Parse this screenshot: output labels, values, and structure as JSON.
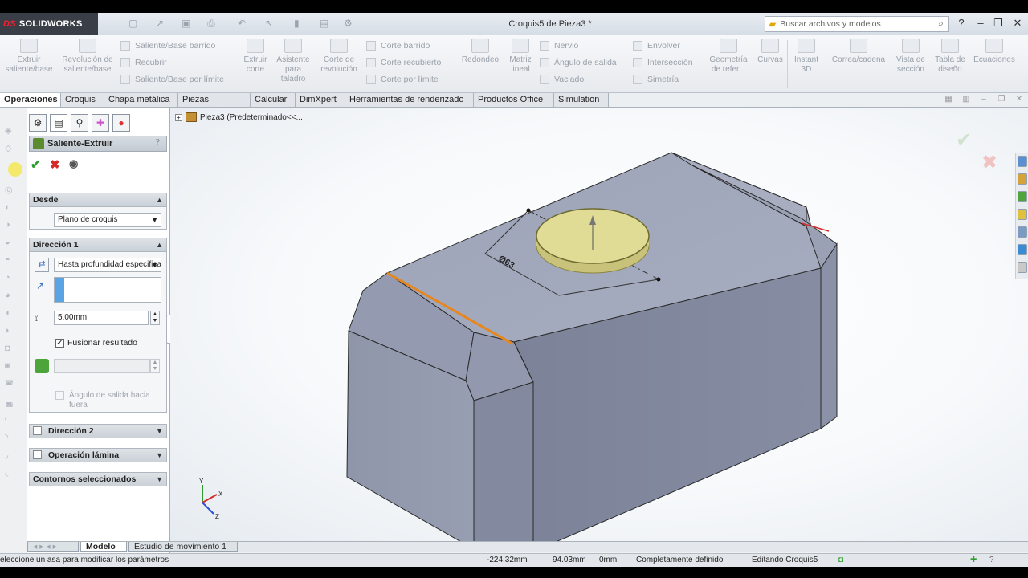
{
  "app": {
    "logo": "SOLIDWORKS",
    "document_title": "Croquis5 de Pieza3 *",
    "search_placeholder": "Buscar archivos y modelos"
  },
  "ribbon": {
    "large": [
      {
        "label": "Extruir saliente/base"
      },
      {
        "label": "Revolución de saliente/base"
      },
      {
        "label": "Extruir corte"
      },
      {
        "label": "Asistente para taladro"
      },
      {
        "label": "Corte de revolución"
      },
      {
        "label": "Redondeo"
      },
      {
        "label": "Matriz lineal"
      },
      {
        "label": "Geometría de refer..."
      },
      {
        "label": "Curvas"
      },
      {
        "label": "Instant 3D"
      },
      {
        "label": "Correa/cadena"
      },
      {
        "label": "Vista de sección"
      },
      {
        "label": "Tabla de diseño"
      },
      {
        "label": "Ecuaciones"
      }
    ],
    "small": [
      {
        "label": "Saliente/Base barrido"
      },
      {
        "label": "Recubrir"
      },
      {
        "label": "Saliente/Base por límite"
      },
      {
        "label": "Corte barrido"
      },
      {
        "label": "Corte recubierto"
      },
      {
        "label": "Corte por límite"
      },
      {
        "label": "Nervio"
      },
      {
        "label": "Ángulo de salida"
      },
      {
        "label": "Vaciado"
      },
      {
        "label": "Envolver"
      },
      {
        "label": "Intersección"
      },
      {
        "label": "Simetría"
      }
    ]
  },
  "tabs": [
    "Operaciones",
    "Croquis",
    "Chapa metálica",
    "Piezas soldadas",
    "Calcular",
    "DimXpert",
    "Herramientas de renderizado",
    "Productos Office",
    "Simulation"
  ],
  "tree_flyout": "Pieza3  (Predeterminado<<...",
  "property_manager": {
    "title": "Saliente-Extruir",
    "help": "?",
    "desde": {
      "title": "Desde",
      "value": "Plano de croquis"
    },
    "direccion1": {
      "title": "Dirección 1",
      "end_condition": "Hasta profundidad especificada",
      "depth": "5.00mm",
      "merge_label": "Fusionar resultado",
      "merge_checked": true,
      "draft_label": "Ángulo de salida hacia fuera"
    },
    "direccion2": "Dirección 2",
    "operacion_lamina": "Operación lámina",
    "contornos": "Contornos seleccionados"
  },
  "model": {
    "dimension_label": "Ø63"
  },
  "bottom_tabs": [
    "Modelo",
    "Estudio de movimiento 1"
  ],
  "status": {
    "message": "eleccione un asa para modificar los parámetros",
    "x": "-224.32mm",
    "y": "94.03mm",
    "z": "0mm",
    "state": "Completamente definido",
    "editing": "Editando Croquis5"
  },
  "colors": {
    "body": "#8c93a8",
    "body_top": "#a3a9bc",
    "cylinder": "#d9d68a",
    "edge_highlight": "#e8861e",
    "accept": "#2e9d2e",
    "cancel": "#d42a2a"
  }
}
